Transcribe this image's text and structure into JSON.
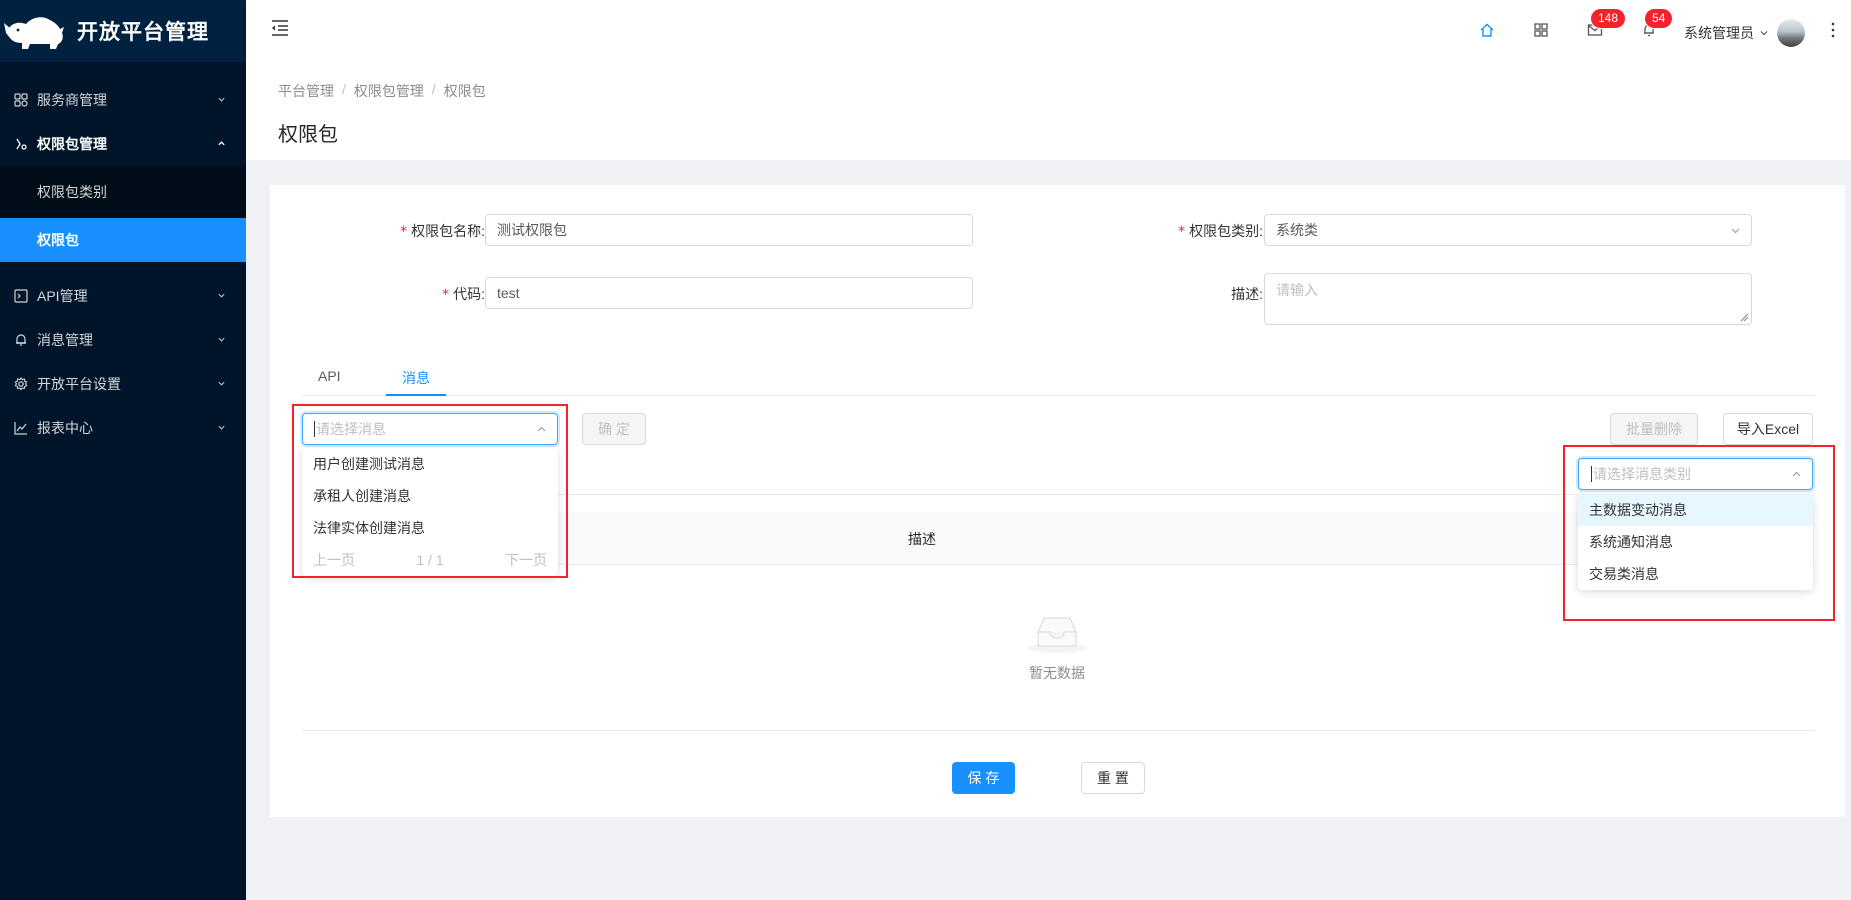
{
  "app": {
    "title": "开放平台管理"
  },
  "sidebar": {
    "items": [
      {
        "label": "服务商管理",
        "icon": "cluster-icon"
      },
      {
        "label": "权限包管理",
        "icon": "api-icon"
      },
      {
        "label": "API管理",
        "icon": "code-icon"
      },
      {
        "label": "消息管理",
        "icon": "bell-icon"
      },
      {
        "label": "开放平台设置",
        "icon": "setting-icon"
      },
      {
        "label": "报表中心",
        "icon": "line-chart-icon"
      }
    ],
    "sub_items": [
      {
        "label": "权限包类别"
      },
      {
        "label": "权限包"
      }
    ]
  },
  "header": {
    "mail_badge": "148",
    "bell_badge": "54",
    "username": "系统管理员"
  },
  "breadcrumb": [
    "平台管理",
    "权限包管理",
    "权限包"
  ],
  "breadcrumb_separator": "/",
  "page_title": "权限包",
  "form": {
    "name_label": "权限包名称:",
    "name_value": "测试权限包",
    "category_label": "权限包类别:",
    "category_value": "系统类",
    "code_label": "代码:",
    "code_value": "test",
    "desc_label": "描述:",
    "desc_placeholder": "请输入",
    "required_mark": "*"
  },
  "tabs": [
    {
      "label": "API"
    },
    {
      "label": "消息"
    }
  ],
  "message_panel": {
    "select_placeholder": "请选择消息",
    "options": [
      "用户创建测试消息",
      "承租人创建消息",
      "法律实体创建消息"
    ],
    "pager_prev": "上一页",
    "pager_info": "1 / 1",
    "pager_next": "下一页",
    "confirm_label": "确 定",
    "batch_delete_label": "批量删除",
    "import_label": "导入Excel",
    "category_placeholder": "请选择消息类别",
    "category_options": [
      "主数据变动消息",
      "系统通知消息",
      "交易类消息"
    ]
  },
  "table": {
    "columns": [
      "描述"
    ],
    "empty_text": "暂无数据"
  },
  "actions": {
    "save_label": "保 存",
    "reset_label": "重 置"
  },
  "colors": {
    "sidebar_bg": "#001529",
    "primary": "#1890ff",
    "danger": "#f5222d"
  }
}
